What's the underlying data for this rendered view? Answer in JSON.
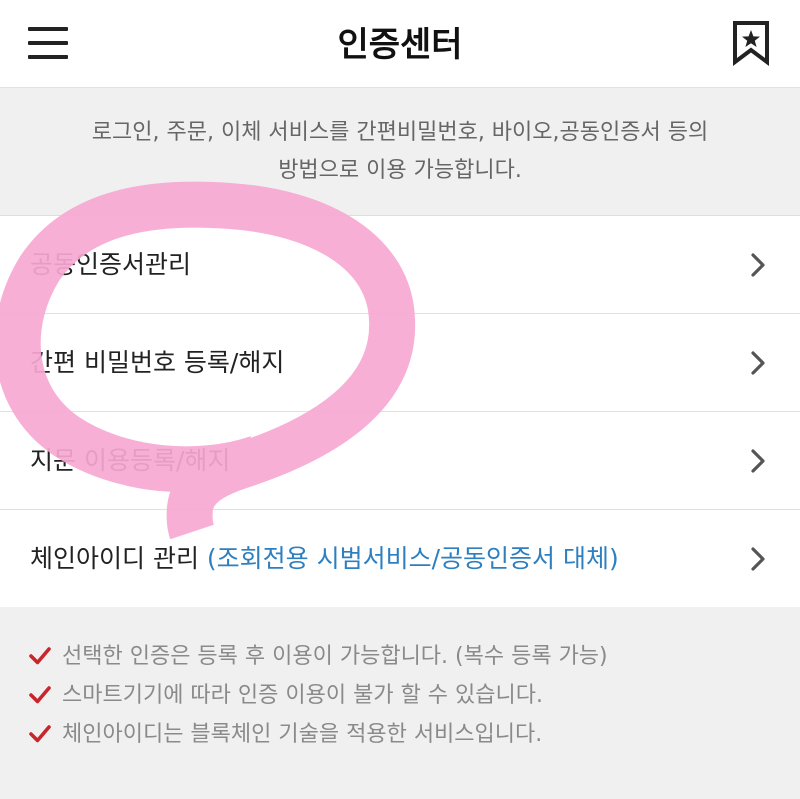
{
  "header": {
    "title": "인증센터",
    "menu_icon": "hamburger-menu-icon",
    "bookmark_icon": "bookmark-star-icon"
  },
  "notice": {
    "line1": "로그인, 주문, 이체 서비스를 간편비밀번호, 바이오,공동인증서 등의",
    "line2": "방법으로 이용 가능합니다."
  },
  "menu": {
    "items": [
      {
        "label": "공동인증서관리",
        "sub": ""
      },
      {
        "label": "간편 비밀번호 등록/해지",
        "sub": ""
      },
      {
        "label": "지문 이용등록/해지",
        "sub": ""
      },
      {
        "label": "체인아이디 관리",
        "sub": "(조회전용 시범서비스/공동인증서 대체)"
      }
    ],
    "chevron_icon": "chevron-right-icon"
  },
  "footer": {
    "notes": [
      "선택한 인증은 등록 후 이용이 가능합니다. (복수 등록 가능)",
      "스마트기기에 따라 인증 이용이 불가 할 수 있습니다.",
      "체인아이디는 블록체인 기술을 적용한 서비스입니다."
    ],
    "check_icon": "checkmark-icon"
  },
  "colors": {
    "accent_blue": "#2e7fc0",
    "check_red": "#c8262c",
    "highlight_pink": "#f7a8d2",
    "notice_bg": "#f0f0f0"
  }
}
